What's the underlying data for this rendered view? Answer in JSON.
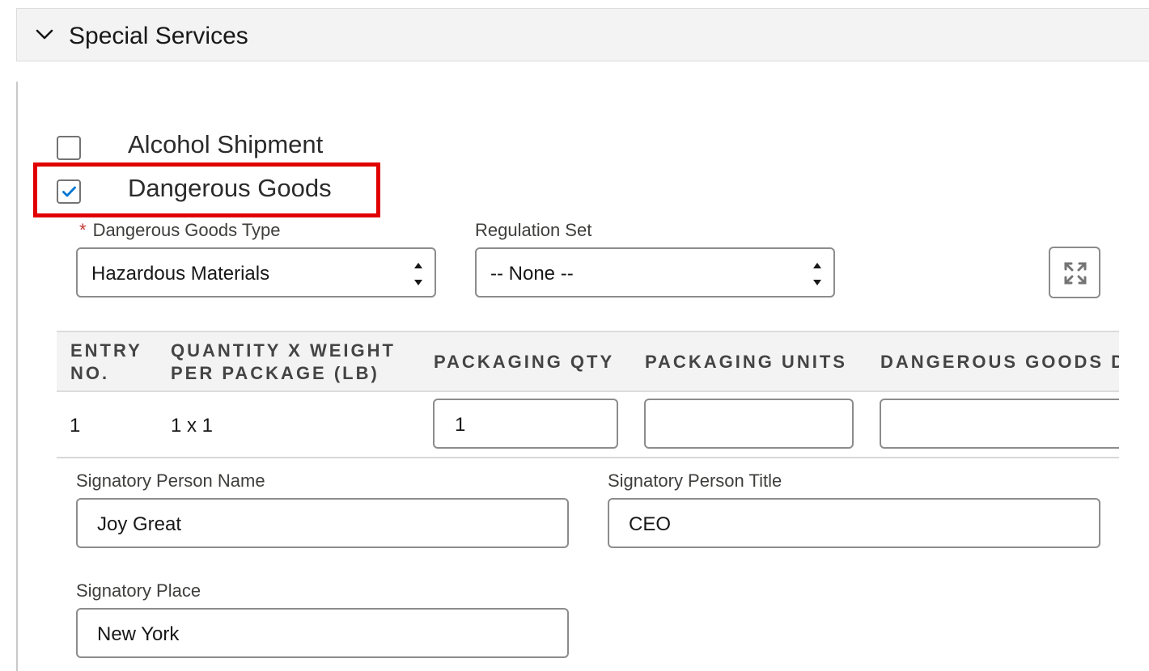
{
  "section": {
    "title": "Special Services",
    "icon": "chevron-down-icon"
  },
  "checkboxes": {
    "alcohol": {
      "label": "Alcohol Shipment",
      "checked": false
    },
    "dangerous": {
      "label": "Dangerous Goods",
      "checked": true
    }
  },
  "fields": {
    "dg_type": {
      "label": "Dangerous Goods Type",
      "required_mark": "*",
      "value": "Hazardous Materials"
    },
    "regulation_set": {
      "label": "Regulation Set",
      "value": "-- None --"
    }
  },
  "expand_button": {
    "icon": "expand-icon"
  },
  "table": {
    "headers": {
      "entry_no_1": "ENTRY",
      "entry_no_2": "NO.",
      "qty_weight_1": "QUANTITY X WEIGHT",
      "qty_weight_2": "PER PACKAGE (LB)",
      "packaging_qty": "PACKAGING QTY",
      "packaging_units": "PACKAGING UNITS",
      "dg_description": "DANGEROUS GOODS D"
    },
    "rows": [
      {
        "entry_no": "1",
        "qty_weight": "1 x 1",
        "packaging_qty": "1",
        "packaging_units": "",
        "dg_description": ""
      }
    ]
  },
  "signatory": {
    "name": {
      "label": "Signatory Person Name",
      "value": "Joy Great"
    },
    "title": {
      "label": "Signatory Person Title",
      "value": "CEO"
    },
    "place": {
      "label": "Signatory Place",
      "value": "New York"
    }
  },
  "colors": {
    "highlight_border": "#e00000",
    "required": "#c23934",
    "check": "#0176d3"
  }
}
